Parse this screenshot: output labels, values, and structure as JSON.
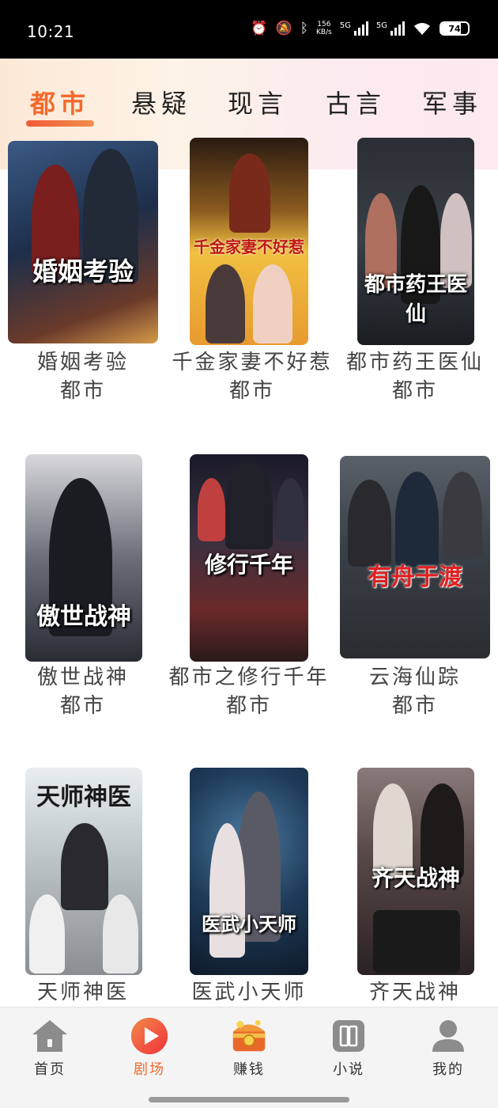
{
  "status_bar": {
    "time": "10:21",
    "net_speed_value": "156",
    "net_speed_unit": "KB/s",
    "signal1_label": "5G",
    "signal2_label": "5G",
    "battery_percent": "74"
  },
  "tabs": [
    {
      "label": "都市",
      "active": true
    },
    {
      "label": "悬疑",
      "active": false
    },
    {
      "label": "现言",
      "active": false
    },
    {
      "label": "古言",
      "active": false
    },
    {
      "label": "军事",
      "active": false
    }
  ],
  "dramas": [
    {
      "title": "婚姻考验",
      "genre": "都市",
      "poster_text": "婚姻考验"
    },
    {
      "title": "千金家妻不好惹",
      "genre": "都市",
      "poster_text": "千金家妻不好惹"
    },
    {
      "title": "都市药王医仙",
      "genre": "都市",
      "poster_text": "都市药王医仙"
    },
    {
      "title": "傲世战神",
      "genre": "都市",
      "poster_text": "傲世战神"
    },
    {
      "title": "都市之修行千年",
      "genre": "都市",
      "poster_text": "修行千年"
    },
    {
      "title": "云海仙踪",
      "genre": "都市",
      "poster_text": "有舟于渡"
    },
    {
      "title": "天师神医",
      "genre": "",
      "poster_text": "天师神医"
    },
    {
      "title": "医武小天师",
      "genre": "",
      "poster_text": "医武小天师"
    },
    {
      "title": "齐天战神",
      "genre": "",
      "poster_text": "齐天战神"
    }
  ],
  "bottom_nav": [
    {
      "label": "首页",
      "icon": "home-icon",
      "active": false
    },
    {
      "label": "剧场",
      "icon": "play-icon",
      "active": true
    },
    {
      "label": "赚钱",
      "icon": "treasure-chest-icon",
      "active": false
    },
    {
      "label": "小说",
      "icon": "book-icon",
      "active": false
    },
    {
      "label": "我的",
      "icon": "user-icon",
      "active": false
    }
  ],
  "colors": {
    "accent": "#f26a2b",
    "status_bar_bg": "#000000",
    "nav_bg": "#f4f4f4"
  }
}
